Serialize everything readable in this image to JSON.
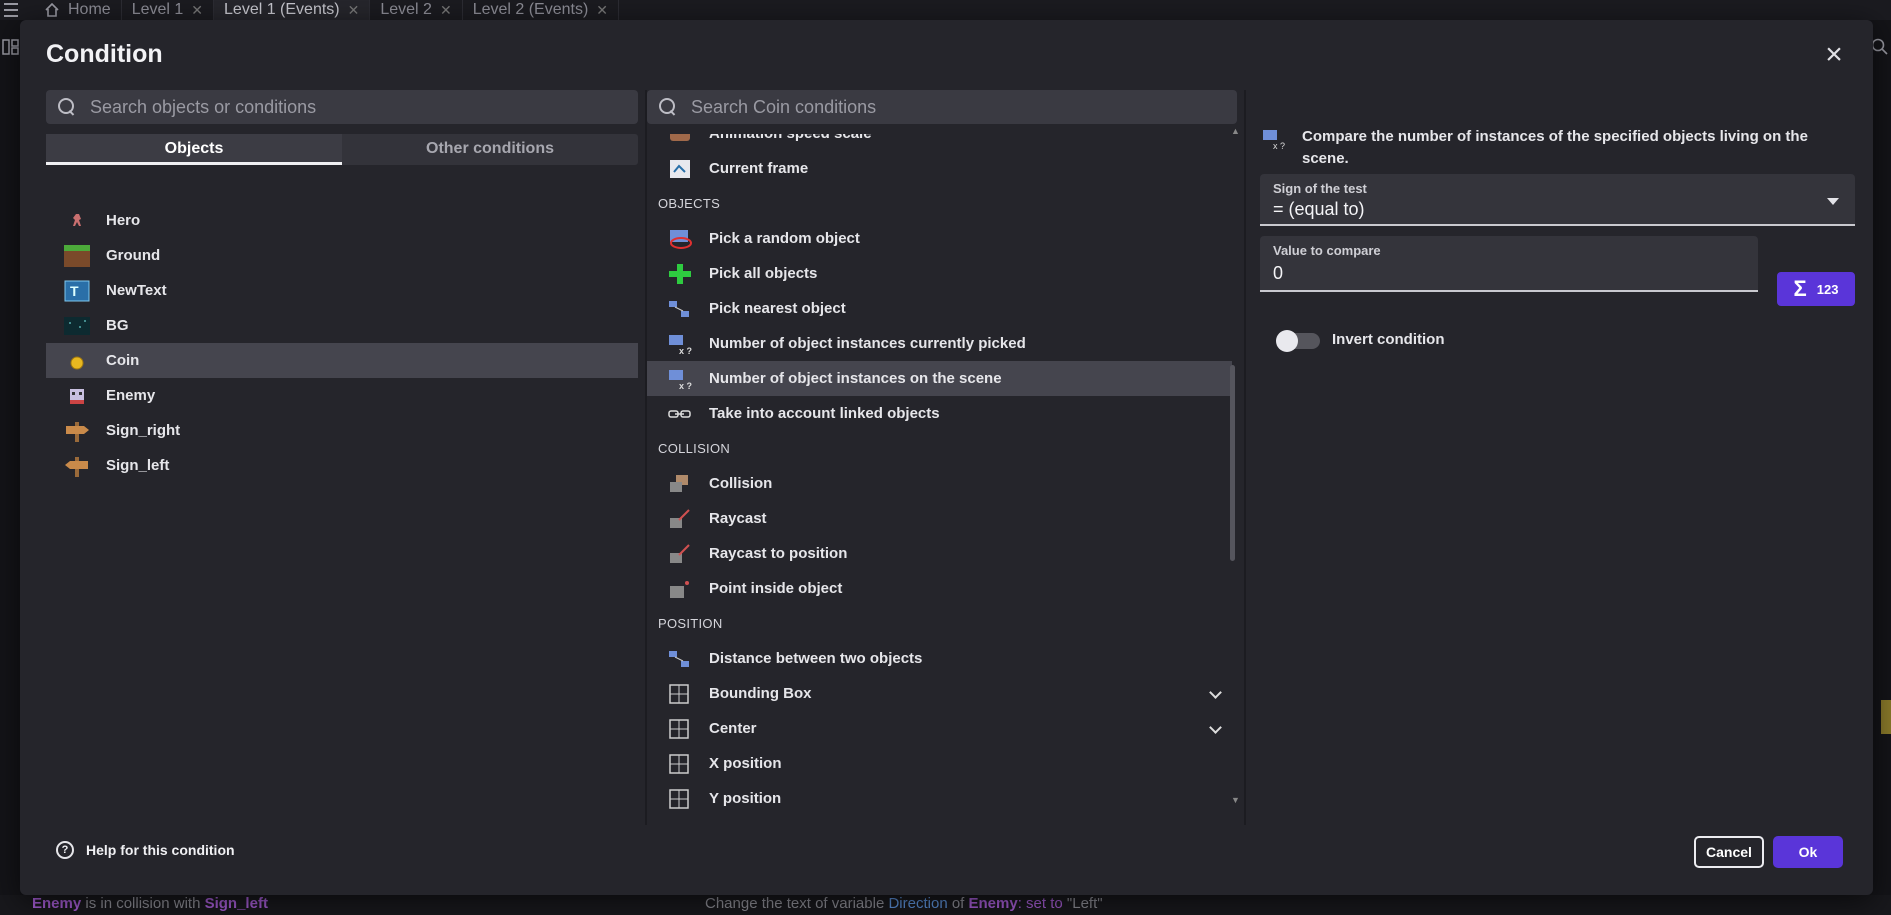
{
  "tabs": [
    {
      "label": "Home",
      "closable": false,
      "active": false
    },
    {
      "label": "Level 1",
      "closable": true,
      "active": false
    },
    {
      "label": "Level 1 (Events)",
      "closable": true,
      "active": true
    },
    {
      "label": "Level 2",
      "closable": true,
      "active": false
    },
    {
      "label": "Level 2 (Events)",
      "closable": true,
      "active": false
    }
  ],
  "background_events": {
    "left_object": "Enemy",
    "left_text": "is in collision with",
    "left_target": "Sign_left",
    "right_text": "Change the text of variable",
    "right_var": "Direction",
    "right_of": "of",
    "right_obj": "Enemy",
    "right_set": ": set to",
    "right_value": "\"Left\""
  },
  "dialog": {
    "title": "Condition",
    "left_search_placeholder": "Search objects or conditions",
    "tabs": {
      "objects": "Objects",
      "other": "Other conditions"
    },
    "objects": [
      {
        "name": "Hero",
        "icon": "hero-sprite-icon",
        "selected": false
      },
      {
        "name": "Ground",
        "icon": "ground-tile-icon",
        "selected": false
      },
      {
        "name": "NewText",
        "icon": "text-object-icon",
        "selected": false
      },
      {
        "name": "BG",
        "icon": "background-icon",
        "selected": false
      },
      {
        "name": "Coin",
        "icon": "coin-icon",
        "selected": true
      },
      {
        "name": "Enemy",
        "icon": "enemy-sprite-icon",
        "selected": false
      },
      {
        "name": "Sign_right",
        "icon": "sign-right-icon",
        "selected": false
      },
      {
        "name": "Sign_left",
        "icon": "sign-left-icon",
        "selected": false
      }
    ],
    "mid_search_placeholder": "Search Coin conditions",
    "conditions": [
      {
        "type": "item",
        "label": "Animation speed scale",
        "icon": "animation-icon"
      },
      {
        "type": "item",
        "label": "Current frame",
        "icon": "frame-icon"
      },
      {
        "type": "header",
        "label": "OBJECTS"
      },
      {
        "type": "item",
        "label": "Pick a random object",
        "icon": "random-object-icon"
      },
      {
        "type": "item",
        "label": "Pick all objects",
        "icon": "pick-all-icon"
      },
      {
        "type": "item",
        "label": "Pick nearest object",
        "icon": "nearest-object-icon"
      },
      {
        "type": "item",
        "label": "Number of object instances currently picked",
        "icon": "count-icon"
      },
      {
        "type": "item",
        "label": "Number of object instances on the scene",
        "icon": "count-icon",
        "selected": true
      },
      {
        "type": "item",
        "label": "Take into account linked objects",
        "icon": "link-icon"
      },
      {
        "type": "header",
        "label": "COLLISION"
      },
      {
        "type": "item",
        "label": "Collision",
        "icon": "collision-icon"
      },
      {
        "type": "item",
        "label": "Raycast",
        "icon": "raycast-icon"
      },
      {
        "type": "item",
        "label": "Raycast to position",
        "icon": "raycast-icon"
      },
      {
        "type": "item",
        "label": "Point inside object",
        "icon": "point-inside-icon"
      },
      {
        "type": "header",
        "label": "POSITION"
      },
      {
        "type": "item",
        "label": "Distance between two objects",
        "icon": "distance-icon"
      },
      {
        "type": "item",
        "label": "Bounding Box",
        "icon": "grid-icon",
        "expandable": true
      },
      {
        "type": "item",
        "label": "Center",
        "icon": "grid-icon",
        "expandable": true
      },
      {
        "type": "item",
        "label": "X position",
        "icon": "grid-icon"
      },
      {
        "type": "item",
        "label": "Y position",
        "icon": "grid-icon"
      }
    ],
    "description": "Compare the number of instances of the specified objects living on the scene.",
    "sign_field": {
      "label": "Sign of the test",
      "value": "= (equal to)"
    },
    "value_field": {
      "label": "Value to compare",
      "value": "0"
    },
    "expression_button": {
      "symbol": "Σ",
      "text": "123"
    },
    "invert": {
      "label": "Invert condition",
      "on": false
    },
    "help_label": "Help for this condition",
    "cancel_label": "Cancel",
    "ok_label": "Ok"
  },
  "colors": {
    "accent": "#5a35d9",
    "selected_row": "#45454e",
    "dialog_bg": "#25252b"
  }
}
